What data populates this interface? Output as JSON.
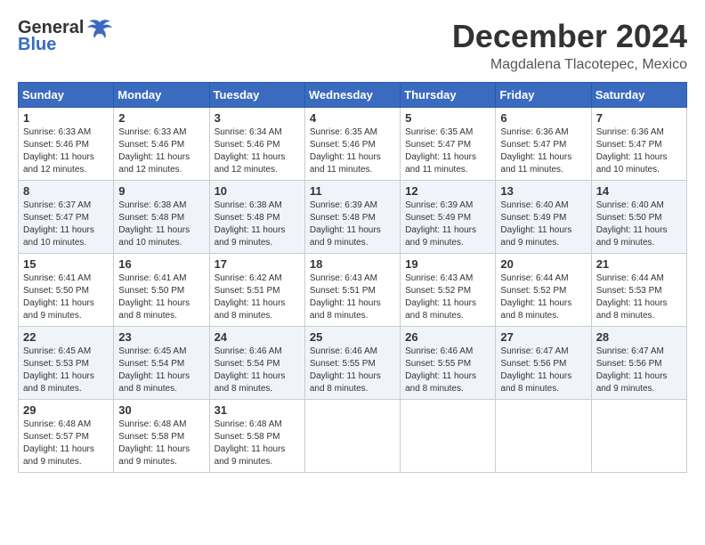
{
  "header": {
    "logo_general": "General",
    "logo_blue": "Blue",
    "month_title": "December 2024",
    "subtitle": "Magdalena Tlacotepec, Mexico"
  },
  "weekdays": [
    "Sunday",
    "Monday",
    "Tuesday",
    "Wednesday",
    "Thursday",
    "Friday",
    "Saturday"
  ],
  "weeks": [
    [
      {
        "day": "1",
        "info": "Sunrise: 6:33 AM\nSunset: 5:46 PM\nDaylight: 11 hours and 12 minutes."
      },
      {
        "day": "2",
        "info": "Sunrise: 6:33 AM\nSunset: 5:46 PM\nDaylight: 11 hours and 12 minutes."
      },
      {
        "day": "3",
        "info": "Sunrise: 6:34 AM\nSunset: 5:46 PM\nDaylight: 11 hours and 12 minutes."
      },
      {
        "day": "4",
        "info": "Sunrise: 6:35 AM\nSunset: 5:46 PM\nDaylight: 11 hours and 11 minutes."
      },
      {
        "day": "5",
        "info": "Sunrise: 6:35 AM\nSunset: 5:47 PM\nDaylight: 11 hours and 11 minutes."
      },
      {
        "day": "6",
        "info": "Sunrise: 6:36 AM\nSunset: 5:47 PM\nDaylight: 11 hours and 11 minutes."
      },
      {
        "day": "7",
        "info": "Sunrise: 6:36 AM\nSunset: 5:47 PM\nDaylight: 11 hours and 10 minutes."
      }
    ],
    [
      {
        "day": "8",
        "info": "Sunrise: 6:37 AM\nSunset: 5:47 PM\nDaylight: 11 hours and 10 minutes."
      },
      {
        "day": "9",
        "info": "Sunrise: 6:38 AM\nSunset: 5:48 PM\nDaylight: 11 hours and 10 minutes."
      },
      {
        "day": "10",
        "info": "Sunrise: 6:38 AM\nSunset: 5:48 PM\nDaylight: 11 hours and 9 minutes."
      },
      {
        "day": "11",
        "info": "Sunrise: 6:39 AM\nSunset: 5:48 PM\nDaylight: 11 hours and 9 minutes."
      },
      {
        "day": "12",
        "info": "Sunrise: 6:39 AM\nSunset: 5:49 PM\nDaylight: 11 hours and 9 minutes."
      },
      {
        "day": "13",
        "info": "Sunrise: 6:40 AM\nSunset: 5:49 PM\nDaylight: 11 hours and 9 minutes."
      },
      {
        "day": "14",
        "info": "Sunrise: 6:40 AM\nSunset: 5:50 PM\nDaylight: 11 hours and 9 minutes."
      }
    ],
    [
      {
        "day": "15",
        "info": "Sunrise: 6:41 AM\nSunset: 5:50 PM\nDaylight: 11 hours and 9 minutes."
      },
      {
        "day": "16",
        "info": "Sunrise: 6:41 AM\nSunset: 5:50 PM\nDaylight: 11 hours and 8 minutes."
      },
      {
        "day": "17",
        "info": "Sunrise: 6:42 AM\nSunset: 5:51 PM\nDaylight: 11 hours and 8 minutes."
      },
      {
        "day": "18",
        "info": "Sunrise: 6:43 AM\nSunset: 5:51 PM\nDaylight: 11 hours and 8 minutes."
      },
      {
        "day": "19",
        "info": "Sunrise: 6:43 AM\nSunset: 5:52 PM\nDaylight: 11 hours and 8 minutes."
      },
      {
        "day": "20",
        "info": "Sunrise: 6:44 AM\nSunset: 5:52 PM\nDaylight: 11 hours and 8 minutes."
      },
      {
        "day": "21",
        "info": "Sunrise: 6:44 AM\nSunset: 5:53 PM\nDaylight: 11 hours and 8 minutes."
      }
    ],
    [
      {
        "day": "22",
        "info": "Sunrise: 6:45 AM\nSunset: 5:53 PM\nDaylight: 11 hours and 8 minutes."
      },
      {
        "day": "23",
        "info": "Sunrise: 6:45 AM\nSunset: 5:54 PM\nDaylight: 11 hours and 8 minutes."
      },
      {
        "day": "24",
        "info": "Sunrise: 6:46 AM\nSunset: 5:54 PM\nDaylight: 11 hours and 8 minutes."
      },
      {
        "day": "25",
        "info": "Sunrise: 6:46 AM\nSunset: 5:55 PM\nDaylight: 11 hours and 8 minutes."
      },
      {
        "day": "26",
        "info": "Sunrise: 6:46 AM\nSunset: 5:55 PM\nDaylight: 11 hours and 8 minutes."
      },
      {
        "day": "27",
        "info": "Sunrise: 6:47 AM\nSunset: 5:56 PM\nDaylight: 11 hours and 8 minutes."
      },
      {
        "day": "28",
        "info": "Sunrise: 6:47 AM\nSunset: 5:56 PM\nDaylight: 11 hours and 9 minutes."
      }
    ],
    [
      {
        "day": "29",
        "info": "Sunrise: 6:48 AM\nSunset: 5:57 PM\nDaylight: 11 hours and 9 minutes."
      },
      {
        "day": "30",
        "info": "Sunrise: 6:48 AM\nSunset: 5:58 PM\nDaylight: 11 hours and 9 minutes."
      },
      {
        "day": "31",
        "info": "Sunrise: 6:48 AM\nSunset: 5:58 PM\nDaylight: 11 hours and 9 minutes."
      },
      null,
      null,
      null,
      null
    ]
  ]
}
